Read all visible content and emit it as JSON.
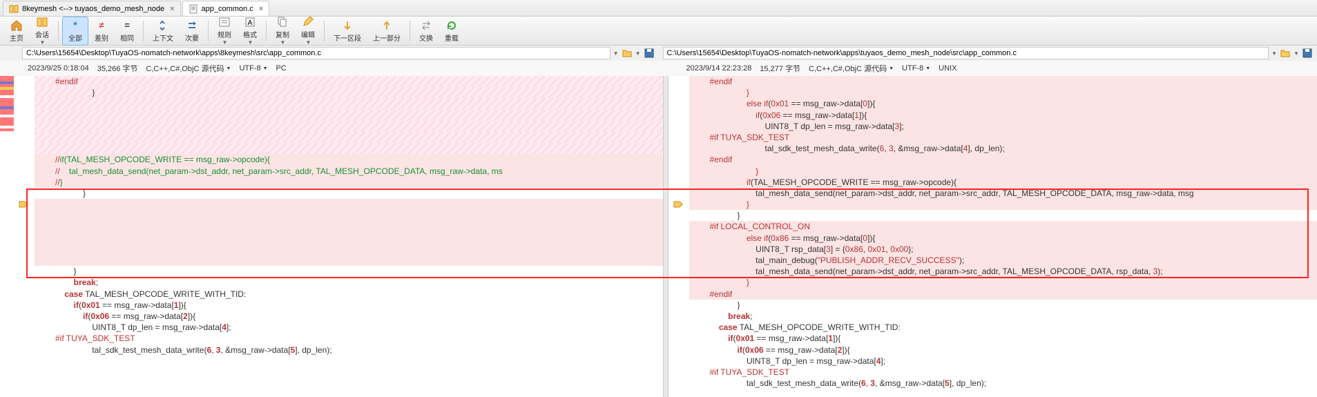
{
  "tabs": [
    {
      "label": "8keymesh <--> tuyaos_demo_mesh_node",
      "icon": "compare"
    },
    {
      "label": "app_common.c",
      "icon": "file"
    }
  ],
  "toolbar": {
    "home": "主页",
    "session": "会话",
    "all": "全部",
    "diff": "差别",
    "same": "相同",
    "updown": "上下文",
    "next": "次要",
    "rules": "规则",
    "format": "格式",
    "copy": "复制",
    "edit": "编辑",
    "nextsection": "下一区段",
    "prevsection": "上一部分",
    "swap": "交换",
    "reload": "重载"
  },
  "paths": {
    "left": "C:\\Users\\15654\\Desktop\\TuyaOS-nomatch-network\\apps\\8keymesh\\src\\app_common.c",
    "right": "C:\\Users\\15654\\Desktop\\TuyaOS-nomatch-network\\apps\\tuyaos_demo_mesh_node\\src\\app_common.c"
  },
  "info": {
    "left": {
      "date": "2023/9/25 0:18:04",
      "size": "35,266 字节",
      "lang": "C,C++,C#,ObjC 源代码",
      "enc": "UTF-8",
      "eol": "PC"
    },
    "right": {
      "date": "2023/9/14 22:23:28",
      "size": "15,277 字节",
      "lang": "C,C++,C#,ObjC 源代码",
      "enc": "UTF-8",
      "eol": "UNIX"
    }
  },
  "code_left": {
    "l1": "#endif",
    "l2": "                }",
    "l3": "                //if(TAL_MESH_OPCODE_WRITE == msg_raw->opcode){",
    "l4": "//    tal_mesh_data_send(net_param->dst_addr, net_param->src_addr, TAL_MESH_OPCODE_DATA, msg_raw->data, ms",
    "l5": "                //}",
    "l6": "            }",
    "l7": "",
    "l8": "",
    "l9": "",
    "l10": "",
    "l11": "",
    "l12": "",
    "l13": "        }",
    "l14": "        break;",
    "l15": "    case TAL_MESH_OPCODE_WRITE_WITH_TID:",
    "l16": "        if(0x01 == msg_raw->data[1]){",
    "l17": "            if(0x06 == msg_raw->data[2]){",
    "l18": "                UINT8_T dp_len = msg_raw->data[4];",
    "l19": "#if TUYA_SDK_TEST",
    "l20": "                tal_sdk_test_mesh_data_write(6, 3, &msg_raw->data[5], dp_len);"
  },
  "code_right": {
    "l1": "#endif",
    "l2": "                }",
    "l3": "                else if(0x01 == msg_raw->data[0]){",
    "l4": "                    if(0x06 == msg_raw->data[1]){",
    "l5": "                        UINT8_T dp_len = msg_raw->data[3];",
    "l6": "#if TUYA_SDK_TEST",
    "l7": "                        tal_sdk_test_mesh_data_write(6, 3, &msg_raw->data[4], dp_len);",
    "l8": "#endif",
    "l9": "                    }",
    "l10": "                if(TAL_MESH_OPCODE_WRITE == msg_raw->opcode){",
    "l11": "                    tal_mesh_data_send(net_param->dst_addr, net_param->src_addr, TAL_MESH_OPCODE_DATA, msg_raw->data, msg",
    "l12": "                }",
    "l13": "            }",
    "l14": "#if LOCAL_CONTROL_ON",
    "l15": "                else if(0x86 == msg_raw->data[0]){",
    "l16": "                    UINT8_T rsp_data[3] = {0x86, 0x01, 0x00};",
    "l17": "                    tal_main_debug(\"PUBLISH_ADDR_RECV_SUCCESS\");",
    "l18": "                    tal_mesh_data_send(net_param->dst_addr, net_param->src_addr, TAL_MESH_OPCODE_DATA, rsp_data, 3);",
    "l19": "                }",
    "l20": "#endif",
    "l21": "            }",
    "l22": "        break;",
    "l23": "    case TAL_MESH_OPCODE_WRITE_WITH_TID:",
    "l24": "        if(0x01 == msg_raw->data[1]){",
    "l25": "            if(0x06 == msg_raw->data[2]){",
    "l26": "                UINT8_T dp_len = msg_raw->data[4];",
    "l27": "#if TUYA_SDK_TEST",
    "l28": "                tal_sdk_test_mesh_data_write(6, 3, &msg_raw->data[5], dp_len);"
  }
}
